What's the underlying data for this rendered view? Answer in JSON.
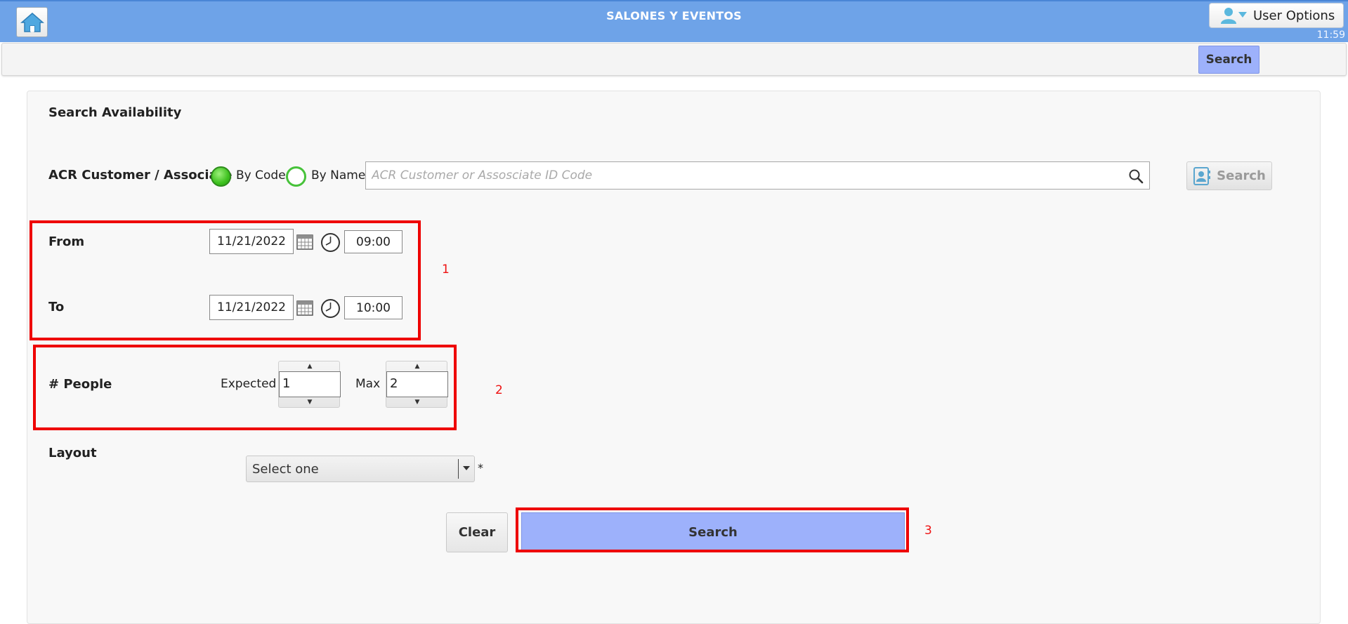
{
  "header": {
    "title": "SALONES Y EVENTOS",
    "user_options_label": "User Options",
    "time": "11:59"
  },
  "toolbar": {
    "search_label": "Search"
  },
  "form": {
    "title": "Search Availability",
    "customer": {
      "label": "ACR Customer / Associate",
      "by_code_label": "By Code",
      "by_name_label": "By Name",
      "selected": "By Code",
      "placeholder": "ACR Customer or Assosciate ID Code",
      "value": "",
      "search_label": "Search"
    },
    "from": {
      "label": "From",
      "date": "11/21/2022",
      "time": "09:00"
    },
    "to": {
      "label": "To",
      "date": "11/21/2022",
      "time": "10:00"
    },
    "people": {
      "label": "# People",
      "expected_label": "Expected",
      "expected_value": "1",
      "max_label": "Max",
      "max_value": "2"
    },
    "layout": {
      "label": "Layout",
      "selected": "Select one",
      "required_marker": "*"
    },
    "clear_label": "Clear",
    "search_label": "Search"
  },
  "annotations": {
    "box1": "1",
    "box2": "2",
    "box3": "3"
  },
  "colors": {
    "header_bg": "#6ea3e8",
    "primary_button": "#9db1fb",
    "annotation_red": "#ee0000",
    "radio_green": "#3ec11f"
  }
}
